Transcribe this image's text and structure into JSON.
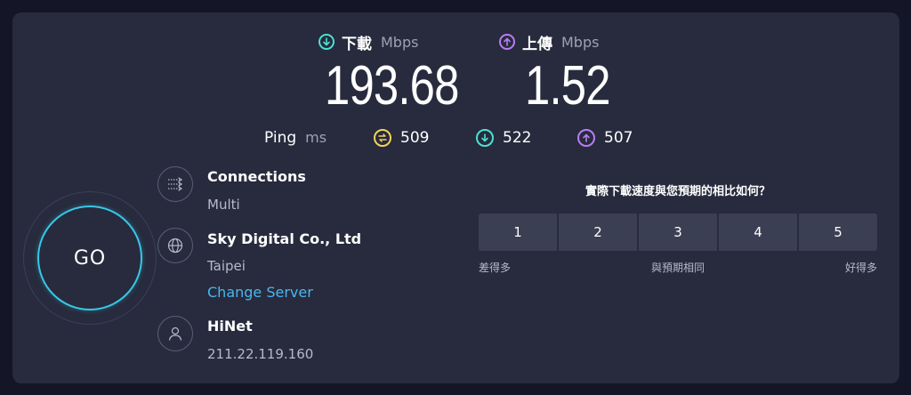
{
  "header": {
    "download": {
      "label": "下載",
      "unit": "Mbps",
      "value": "193.68",
      "icon": "download-arrow-icon",
      "color": "#4ce0d3"
    },
    "upload": {
      "label": "上傳",
      "unit": "Mbps",
      "value": "1.52",
      "icon": "upload-arrow-icon",
      "color": "#b97cf2"
    }
  },
  "ping": {
    "label": "Ping",
    "unit": "ms",
    "idle": {
      "value": "509",
      "icon": "ping-jitter-icon",
      "color": "#f2d35b"
    },
    "download": {
      "value": "522",
      "icon": "download-arrow-icon",
      "color": "#4ce0d3"
    },
    "upload": {
      "value": "507",
      "icon": "upload-arrow-icon",
      "color": "#b97cf2"
    }
  },
  "go_button": {
    "label": "GO",
    "accent": "#37c8e6"
  },
  "connections": {
    "title": "Connections",
    "value": "Multi",
    "icon": "connections-icon"
  },
  "server": {
    "name": "Sky Digital Co., Ltd",
    "location": "Taipei",
    "change_label": "Change Server",
    "icon": "globe-icon"
  },
  "provider": {
    "name": "HiNet",
    "ip": "211.22.119.160",
    "icon": "user-icon"
  },
  "survey": {
    "question": "實際下載速度與您預期的相比如何？",
    "options": [
      "1",
      "2",
      "3",
      "4",
      "5"
    ],
    "labels": {
      "low": "差得多",
      "mid": "與預期相同",
      "high": "好得多"
    }
  }
}
